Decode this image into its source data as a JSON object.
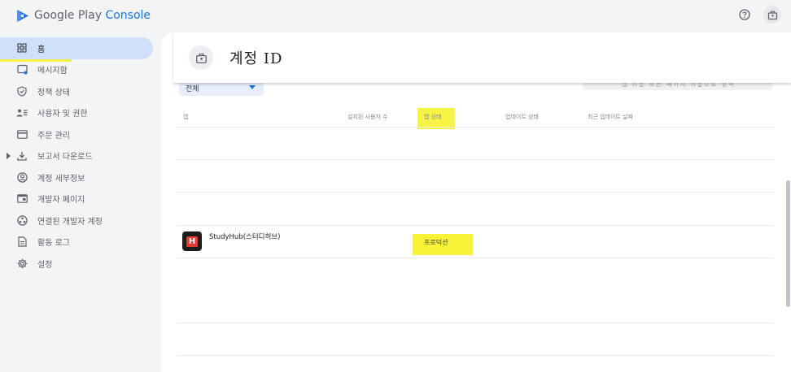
{
  "brand": {
    "name_prefix": "Google Play",
    "name_suffix": "Console",
    "logo_icon": "play-console-logo-icon",
    "accent_color": "#1a73e8"
  },
  "top_actions": [
    {
      "icon": "help-circle-icon"
    },
    {
      "icon": "developer-account-icon"
    }
  ],
  "sidebar": {
    "items": [
      {
        "label": "홈",
        "icon": "grid-icon",
        "active": true
      },
      {
        "label": "메시지함",
        "icon": "inbox-icon"
      },
      {
        "label": "정책 상태",
        "icon": "shield-check-icon"
      },
      {
        "label": "사용자 및 권한",
        "icon": "people-icon"
      },
      {
        "label": "주문 관리",
        "icon": "credit-card-icon"
      },
      {
        "label": "보고서 다운로드",
        "icon": "download-icon",
        "expandable": true
      },
      {
        "label": "계정 세부정보",
        "icon": "account-circle-icon"
      },
      {
        "label": "개발자 페이지",
        "icon": "web-page-icon"
      },
      {
        "label": "연결된 개발자 계정",
        "icon": "linked-accounts-icon"
      },
      {
        "label": "활동 로그",
        "icon": "document-icon"
      },
      {
        "label": "설정",
        "icon": "gear-icon"
      }
    ]
  },
  "header": {
    "avatar_icon": "developer-account-icon",
    "title": "계정 ID"
  },
  "filters": {
    "select_value": "전체",
    "search_placeholder": "앱 이름 또는 패키지 이름으로 검색"
  },
  "table": {
    "columns": [
      "앱",
      "설치된 사용자 수",
      "앱 상태",
      "업데이트 상태",
      "최근 업데이트 날짜"
    ],
    "rows": [
      {
        "app_name": "StudyHub(스터디허브)",
        "app_status": "프로덕션",
        "icon_letter": "H"
      }
    ]
  },
  "highlight_color": "#f7f224"
}
